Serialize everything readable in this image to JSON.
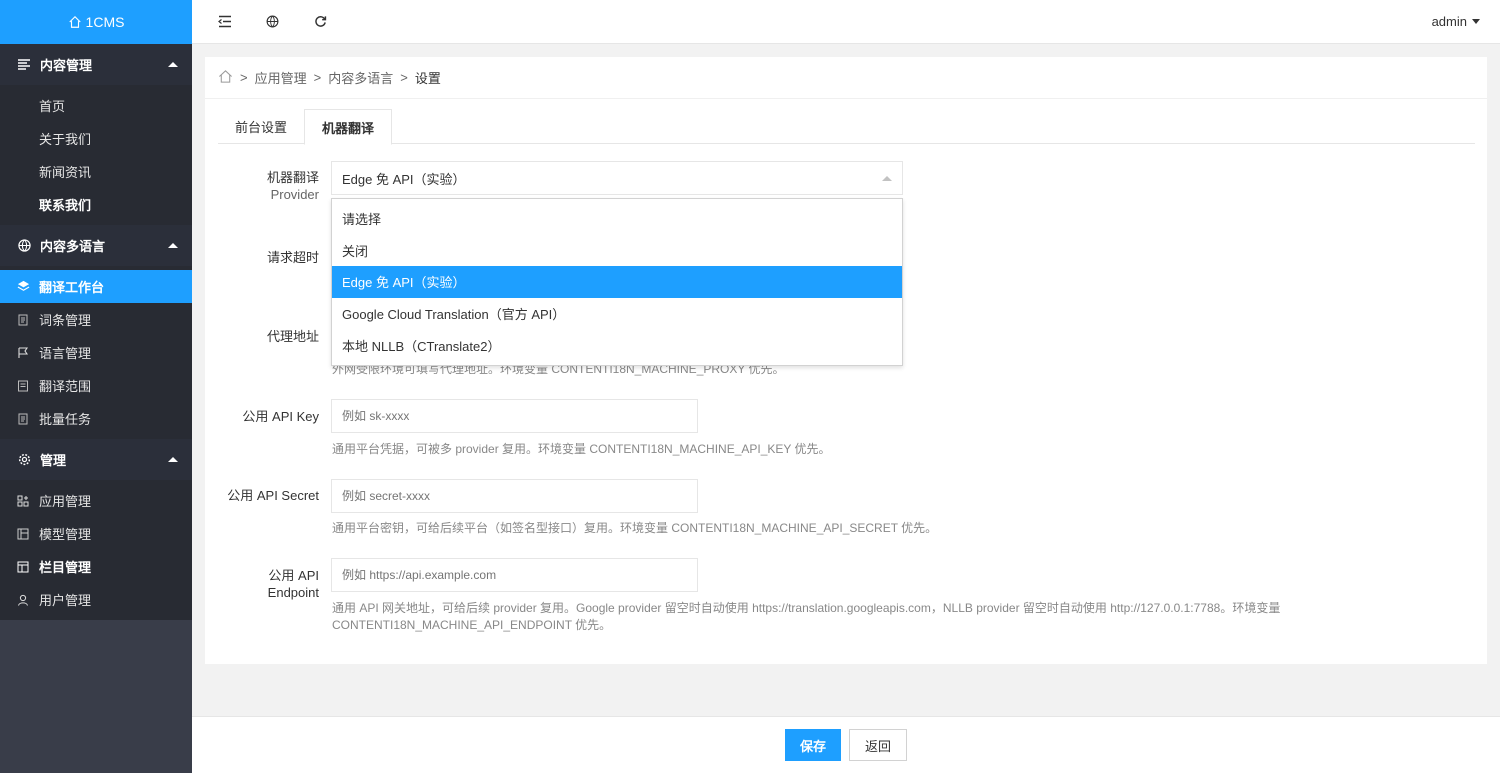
{
  "app": {
    "logo": "1CMS"
  },
  "sidebar": {
    "groups": [
      {
        "label": "内容管理",
        "icon": "list-icon",
        "items": [
          {
            "label": "首页"
          },
          {
            "label": "关于我们"
          },
          {
            "label": "新闻资讯"
          },
          {
            "label": "联系我们"
          }
        ]
      },
      {
        "label": "内容多语言",
        "icon": "globe-icon",
        "items": [
          {
            "label": "翻译工作台",
            "icon": "layers-icon",
            "active": true
          },
          {
            "label": "词条管理",
            "icon": "document-icon"
          },
          {
            "label": "语言管理",
            "icon": "flag-icon"
          },
          {
            "label": "翻译范围",
            "icon": "form-icon"
          },
          {
            "label": "批量任务",
            "icon": "document-icon"
          }
        ]
      },
      {
        "label": "管理",
        "icon": "gear-icon",
        "items": [
          {
            "label": "应用管理",
            "icon": "apps-icon"
          },
          {
            "label": "模型管理",
            "icon": "model-icon"
          },
          {
            "label": "栏目管理",
            "icon": "columns-icon"
          },
          {
            "label": "用户管理",
            "icon": "user-icon"
          }
        ]
      }
    ]
  },
  "topbar": {
    "user": "admin"
  },
  "breadcrumb": {
    "sep": ">",
    "items": [
      "应用管理",
      "内容多语言",
      "设置"
    ]
  },
  "tabs": [
    {
      "label": "前台设置"
    },
    {
      "label": "机器翻译",
      "active": true
    }
  ],
  "form": {
    "provider": {
      "label1": "机器翻译",
      "label2": "Provider",
      "value": "Edge 免 API（实验）",
      "options": [
        "请选择",
        "关闭",
        "Edge 免 API（实验）",
        "Google Cloud Translation（官方 API）",
        "本地 NLLB（CTranslate2）"
      ],
      "selected_index": 2
    },
    "timeout": {
      "label": "请求超时"
    },
    "proxy": {
      "label": "代理地址",
      "hint": "外网受限环境可填写代理地址。环境变量 CONTENTI18N_MACHINE_PROXY 优先。"
    },
    "api_key": {
      "label": "公用 API Key",
      "placeholder": "例如 sk-xxxx",
      "hint": "通用平台凭据，可被多 provider 复用。环境变量 CONTENTI18N_MACHINE_API_KEY 优先。"
    },
    "api_secret": {
      "label": "公用 API Secret",
      "placeholder": "例如 secret-xxxx",
      "hint": "通用平台密钥，可给后续平台（如签名型接口）复用。环境变量 CONTENTI18N_MACHINE_API_SECRET 优先。"
    },
    "api_endpoint": {
      "label1": "公用 API",
      "label2": "Endpoint",
      "placeholder": "例如 https://api.example.com",
      "hint1": "通用 API 网关地址，可给后续 provider 复用。Google provider 留空时自动使用 https://translation.googleapis.com，NLLB provider 留空时自动使用 http://127.0.0.1:7788。环境变量",
      "hint2": "CONTENTI18N_MACHINE_API_ENDPOINT 优先。"
    }
  },
  "footer": {
    "save": "保存",
    "back": "返回"
  },
  "colors": {
    "accent": "#1e9fff",
    "sidebar": "#393d49",
    "sidebar_dark": "#2b2f3a"
  }
}
